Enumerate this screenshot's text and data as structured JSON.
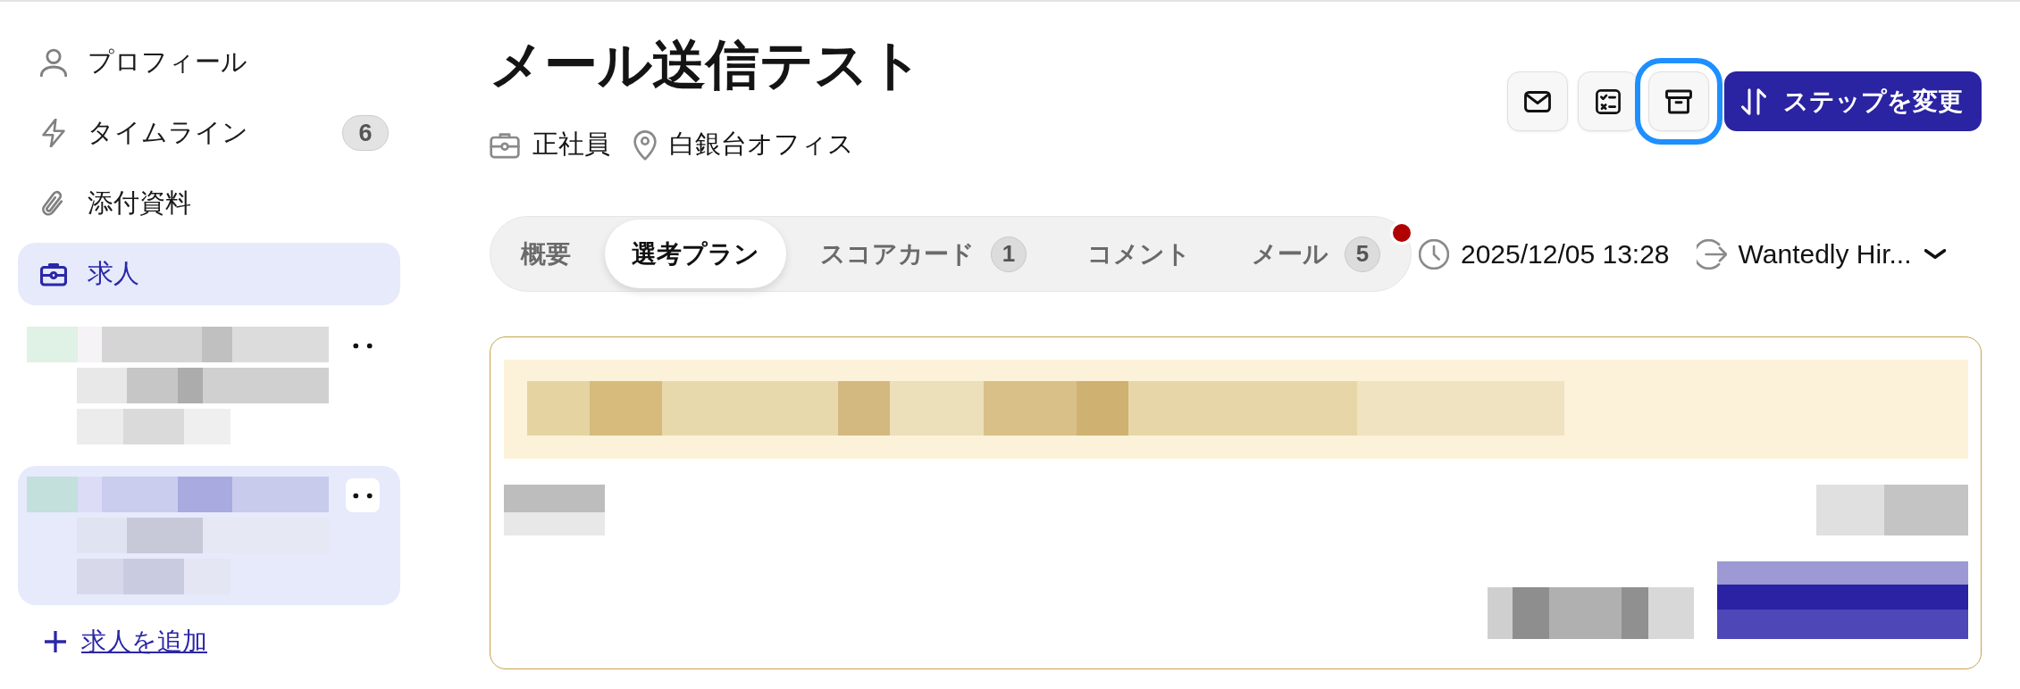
{
  "sidebar": {
    "items": [
      {
        "kind": "profile",
        "label": "プロフィール",
        "selected": false
      },
      {
        "kind": "timeline",
        "label": "タイムライン",
        "badge": "6",
        "selected": false
      },
      {
        "kind": "attachments",
        "label": "添付資料",
        "selected": false
      },
      {
        "kind": "jobs",
        "label": "求人",
        "selected": true
      }
    ],
    "job_postings": [
      {
        "selected": false
      },
      {
        "selected": true
      }
    ],
    "add_job": {
      "label": "求人を追加"
    }
  },
  "header": {
    "title": "メール送信テスト",
    "meta": [
      {
        "kind": "employment",
        "text": "正社員"
      },
      {
        "kind": "location",
        "text": "白銀台オフィス"
      }
    ]
  },
  "toolbar": {
    "icon_buttons": [
      {
        "kind": "mail",
        "focused": false
      },
      {
        "kind": "checklist",
        "focused": false
      },
      {
        "kind": "archive",
        "focused": true
      }
    ],
    "primary_button": {
      "label": "ステップを変更"
    }
  },
  "tab_bar": {
    "tabs": [
      {
        "label": "概要",
        "selected": false
      },
      {
        "label": "選考プラン",
        "selected": true
      },
      {
        "label": "スコアカード",
        "badge": "1",
        "selected": false
      },
      {
        "label": "コメント",
        "selected": false
      },
      {
        "label": "メール",
        "badge": "5",
        "selected": false
      }
    ],
    "unread_dot": true
  },
  "info": {
    "datetime": "2025/12/05 13:28",
    "source": "Wantedly Hir..."
  }
}
